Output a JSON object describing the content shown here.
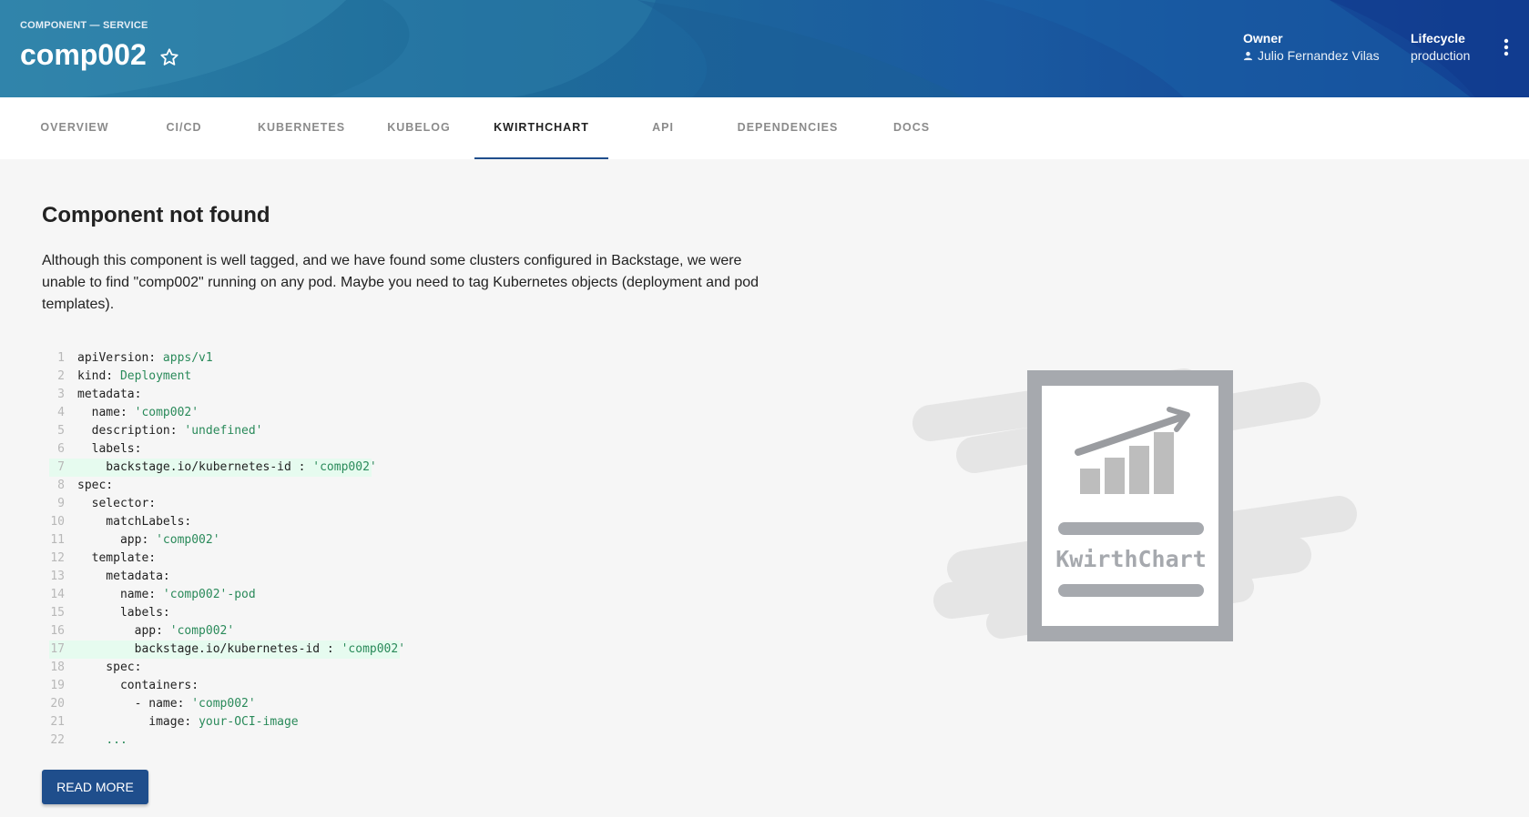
{
  "header": {
    "kind": "COMPONENT — SERVICE",
    "title": "comp002",
    "owner_label": "Owner",
    "owner_value": "Julio Fernandez Vilas",
    "lifecycle_label": "Lifecycle",
    "lifecycle_value": "production"
  },
  "tabs": [
    {
      "label": "OVERVIEW"
    },
    {
      "label": "CI/CD"
    },
    {
      "label": "KUBERNETES"
    },
    {
      "label": "KUBELOG"
    },
    {
      "label": "KWIRTHCHART",
      "active": true
    },
    {
      "label": "API"
    },
    {
      "label": "DEPENDENCIES"
    },
    {
      "label": "DOCS"
    }
  ],
  "main": {
    "heading": "Component not found",
    "paragraph": "Although this component is well tagged, and we have found some clusters configured in Backstage, we were unable to find \"comp002\" running on any pod. Maybe you need to tag Kubernetes objects (deployment and pod templates).",
    "read_more": "READ MORE",
    "illustration_label": "KwirthChart"
  },
  "code": [
    {
      "n": "1",
      "key": "apiVersion: ",
      "val": "apps/v1",
      "rest": ""
    },
    {
      "n": "2",
      "key": "kind: ",
      "val": "Deployment",
      "rest": ""
    },
    {
      "n": "3",
      "key": "metadata:",
      "val": "",
      "rest": ""
    },
    {
      "n": "4",
      "key": "  name: ",
      "val": "'comp002'",
      "rest": ""
    },
    {
      "n": "5",
      "key": "  description: ",
      "val": "'undefined'",
      "rest": ""
    },
    {
      "n": "6",
      "key": "  labels:",
      "val": "",
      "rest": ""
    },
    {
      "n": "7",
      "key": "    backstage.io/kubernetes-id : ",
      "val": "'comp002'",
      "rest": "",
      "highlight": true
    },
    {
      "n": "8",
      "key": "spec:",
      "val": "",
      "rest": ""
    },
    {
      "n": "9",
      "key": "  selector:",
      "val": "",
      "rest": ""
    },
    {
      "n": "10",
      "key": "    matchLabels:",
      "val": "",
      "rest": ""
    },
    {
      "n": "11",
      "key": "      app: ",
      "val": "'comp002'",
      "rest": ""
    },
    {
      "n": "12",
      "key": "  template:",
      "val": "",
      "rest": ""
    },
    {
      "n": "13",
      "key": "    metadata:",
      "val": "",
      "rest": ""
    },
    {
      "n": "14",
      "key": "      name: ",
      "val": "'comp002'",
      "rest": "-pod"
    },
    {
      "n": "15",
      "key": "      labels:",
      "val": "",
      "rest": ""
    },
    {
      "n": "16",
      "key": "        app: ",
      "val": "'comp002'",
      "rest": ""
    },
    {
      "n": "17",
      "key": "        backstage.io/kubernetes-id : ",
      "val": "'comp002'",
      "rest": "",
      "highlight": true
    },
    {
      "n": "18",
      "key": "    spec:",
      "val": "",
      "rest": ""
    },
    {
      "n": "19",
      "key": "      containers:",
      "val": "",
      "rest": ""
    },
    {
      "n": "20",
      "key": "        - name: ",
      "val": "'comp002'",
      "rest": ""
    },
    {
      "n": "21",
      "key": "          image: ",
      "val": "your-OCI-image",
      "rest": ""
    },
    {
      "n": "22",
      "key": "    ",
      "val": "...",
      "rest": ""
    }
  ],
  "colors": {
    "accent": "#1f4e8c",
    "code_string": "#2a8a5a",
    "highlight": "#e6fbef"
  },
  "icons": [
    "star-icon",
    "person-icon",
    "kebab-menu-icon"
  ]
}
